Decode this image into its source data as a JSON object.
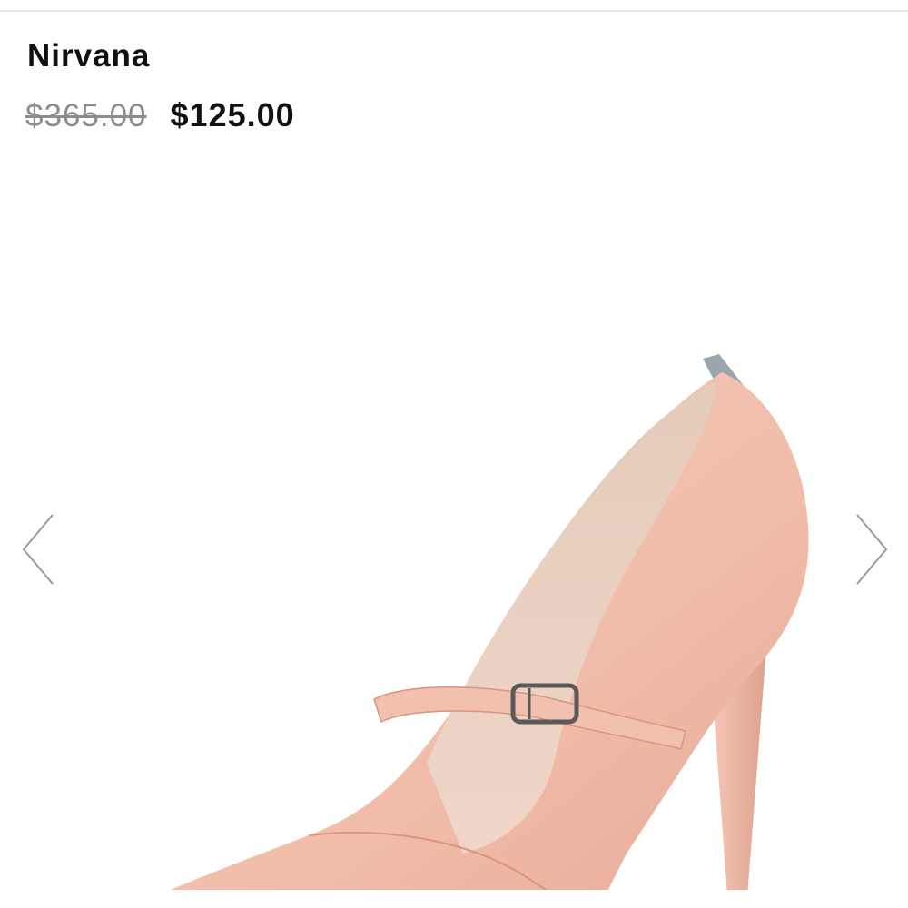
{
  "product": {
    "name": "Nirvana",
    "price_original": "$365.00",
    "price_sale": "$125.00"
  },
  "carousel": {
    "prev_icon": "chevron-left-icon",
    "next_icon": "chevron-right-icon",
    "image_subject": "pink patent leather pointed-toe pump with buckle strap"
  },
  "colors": {
    "shoe_pink": "#f3c3b4",
    "shoe_shadow": "#e1a897",
    "lining": "#e9d2c3",
    "heel_tab": "#9aa6ad",
    "buckle": "#5a5a5a"
  }
}
